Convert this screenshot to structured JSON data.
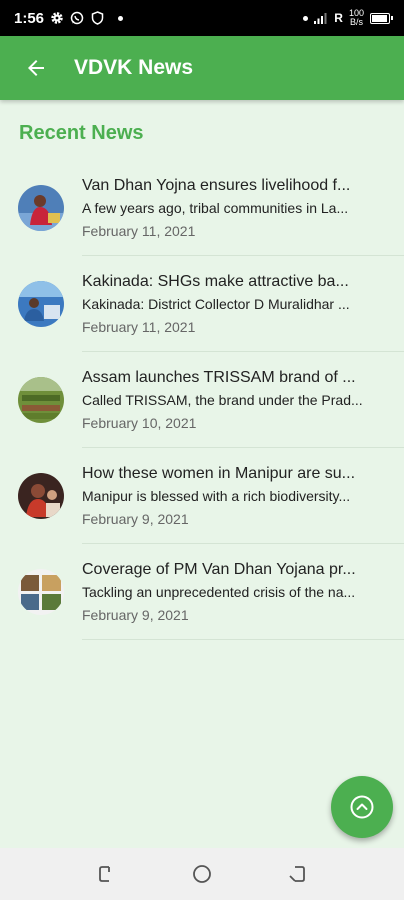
{
  "status_bar": {
    "time": "1:56",
    "left_icons": [
      "settings-icon",
      "whatsapp-icon",
      "shield-icon"
    ],
    "right_icons": [
      "vibrate-dot",
      "signal-icon",
      "network-type-r",
      "data-speed",
      "battery-icon"
    ],
    "network_type": "R",
    "data_speed_top": "100",
    "data_speed_bottom": "B/s",
    "battery_level": 0.85
  },
  "app_bar": {
    "title": "VDVK News",
    "back_icon": "arrow-left-icon",
    "color": "#4caf50"
  },
  "section": {
    "title": "Recent News"
  },
  "news": [
    {
      "title": "Van Dhan Yojna ensures livelihood f...",
      "snippet": "A few years ago, tribal communities in La...",
      "date": "February 11, 2021"
    },
    {
      "title": "Kakinada: SHGs make attractive ba...",
      "snippet": "Kakinada: District Collector D Muralidhar ...",
      "date": "February 11, 2021"
    },
    {
      "title": "Assam launches TRISSAM brand of ...",
      "snippet": "Called TRISSAM, the brand under the Prad...",
      "date": "February 10, 2021"
    },
    {
      "title": "How these women in Manipur are su...",
      "snippet": "Manipur is blessed with a rich biodiversity...",
      "date": "February 9, 2021"
    },
    {
      "title": "Coverage of PM Van Dhan Yojana pr...",
      "snippet": "Tackling an unprecedented crisis of the na...",
      "date": "February 9, 2021"
    }
  ],
  "fab": {
    "icon": "chevron-up-circle-icon"
  },
  "nav_bar": {
    "icons": [
      "recent-apps-icon",
      "home-icon",
      "back-icon"
    ]
  }
}
